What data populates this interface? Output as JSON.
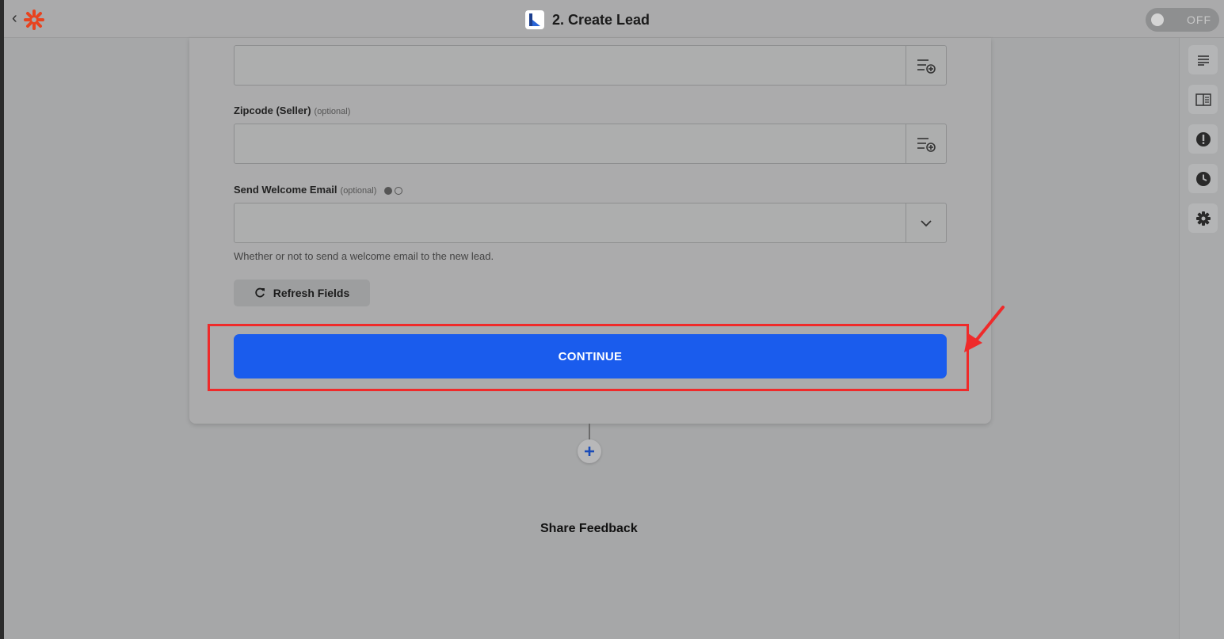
{
  "header": {
    "title": "2. Create Lead",
    "toggle_label": "OFF"
  },
  "form": {
    "zipcode_label": "Zipcode (Seller)",
    "zipcode_optional": "(optional)",
    "welcome_label": "Send Welcome Email",
    "welcome_optional": "(optional)",
    "welcome_help": "Whether or not to send a welcome email to the new lead.",
    "refresh_label": "Refresh Fields",
    "continue_label": "CONTINUE"
  },
  "footer": {
    "feedback_label": "Share Feedback"
  },
  "colors": {
    "primary": "#1a5ced",
    "highlight": "#ef2a2a",
    "brand": "#ff4a00"
  },
  "icons": {
    "right_rail": [
      "outline-icon",
      "guide-icon",
      "alert-icon",
      "history-icon",
      "settings-icon"
    ]
  }
}
